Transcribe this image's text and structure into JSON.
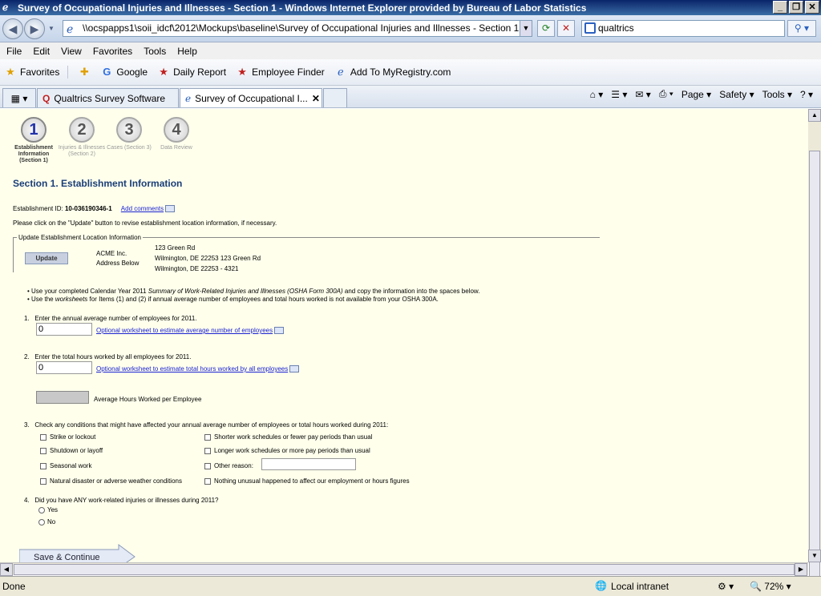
{
  "window": {
    "title": "Survey of Occupational Injuries and Illnesses - Section 1 - Windows Internet Explorer provided by Bureau of Labor Statistics"
  },
  "address": {
    "url": "\\\\ocspapps1\\soii_idcf\\2012\\Mockups\\baseline\\Survey of Occupational Injuries and Illnesses - Section 1.htm"
  },
  "search": {
    "value": "qualtrics"
  },
  "menu": [
    "File",
    "Edit",
    "View",
    "Favorites",
    "Tools",
    "Help"
  ],
  "favorites": {
    "label": "Favorites",
    "items": [
      "Google",
      "Daily Report",
      "Employee Finder",
      "Add To MyRegistry.com"
    ]
  },
  "tabs": [
    "Qualtrics Survey Software",
    "Survey of Occupational I..."
  ],
  "commandbar": {
    "page": "Page",
    "safety": "Safety",
    "tools": "Tools"
  },
  "steps": [
    {
      "num": "1",
      "label": "Establishment Information (Section 1)"
    },
    {
      "num": "2",
      "label": "Injuries & Illnesses (Section 2)"
    },
    {
      "num": "3",
      "label": "Cases (Section 3)"
    },
    {
      "num": "4",
      "label": "Data Review"
    }
  ],
  "section": {
    "title": "Section 1. Establishment Information",
    "est_id_label": "Establishment ID:",
    "est_id": "10-036190346-1",
    "add_comments": "Add comments",
    "update_note": "Please click on the \"Update\" button to revise establishment location information, if necessary.",
    "fieldset_legend": "Update Establishment Location Information",
    "update_button": "Update",
    "company": "ACME Inc.",
    "address_below": "Address Below",
    "addr_line1": "123 Green Rd",
    "addr_line2": "Wilmington,  DE  22253 123 Green Rd",
    "addr_line3": "Wilmington,   DE    22253 - 4321",
    "bullet1_a": "Use your completed Calendar Year 2011",
    "bullet1_b": "Summary of Work-Related Injuries and Illnesses (OSHA Form 300A)",
    "bullet1_c": "and copy the information into the spaces below.",
    "bullet2_a": "Use the",
    "bullet2_b": "worksheets",
    "bullet2_c": "for Items (1) and (2) if annual average number of employees and total hours worked is not available from your OSHA 300A.",
    "q1_label": "Enter the annual average number of employees for 2011.",
    "q1_value": "0",
    "q1_link": "Optional worksheet to estimate average number of employees",
    "q2_label": "Enter the total hours worked by all employees for 2011.",
    "q2_value": "0",
    "q2_link": "Optional worksheet to estimate total hours worked by all employees",
    "avg_hours_label": "Average Hours Worked per Employee",
    "q3_label": "Check any conditions that might have affected your annual average number of employees or total hours worked during 2011:",
    "conditions_left": [
      "Strike or lockout",
      "Shutdown or layoff",
      "Seasonal work",
      "Natural disaster or adverse weather conditions"
    ],
    "conditions_right": [
      "Shorter work schedules or fewer pay periods than usual",
      "Longer work schedules or more pay periods than usual",
      "Other reason:",
      "Nothing unusual happened to affect our employment or hours figures"
    ],
    "q4_label": "Did you have ANY work-related injuries or illnesses during 2011?",
    "q4_yes": "Yes",
    "q4_no": "No",
    "save_button": "Save & Continue",
    "num1": "1.",
    "num2": "2.",
    "num3": "3.",
    "num4": "4."
  },
  "status": {
    "left": "Done",
    "zone": "Local intranet",
    "zoom": "72%"
  }
}
